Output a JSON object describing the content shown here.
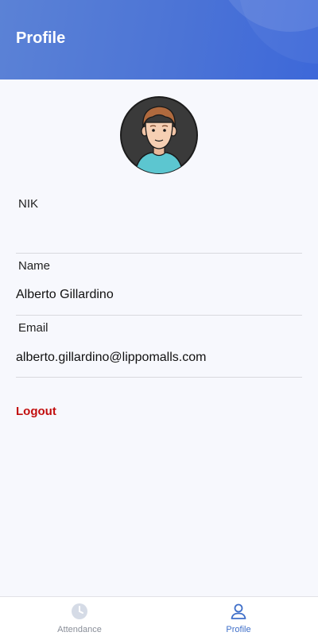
{
  "header": {
    "title": "Profile"
  },
  "profile": {
    "avatar_icon": "male-avatar-icon",
    "fields": [
      {
        "label": "NIK",
        "value": ""
      },
      {
        "label": "Name",
        "value": "Alberto Gillardino"
      },
      {
        "label": "Email",
        "value": "alberto.gillardino@lippomalls.com"
      }
    ],
    "logout_label": "Logout"
  },
  "bottom_nav": {
    "items": [
      {
        "label": "Attendance",
        "icon": "clock-icon",
        "active": false
      },
      {
        "label": "Profile",
        "icon": "person-icon",
        "active": true
      }
    ]
  },
  "colors": {
    "header_gradient_start": "#5b82d6",
    "header_gradient_end": "#3d68d9",
    "logout_red": "#c20e0e",
    "active_nav": "#3f6fc9",
    "inactive_nav": "#8a8f99"
  }
}
